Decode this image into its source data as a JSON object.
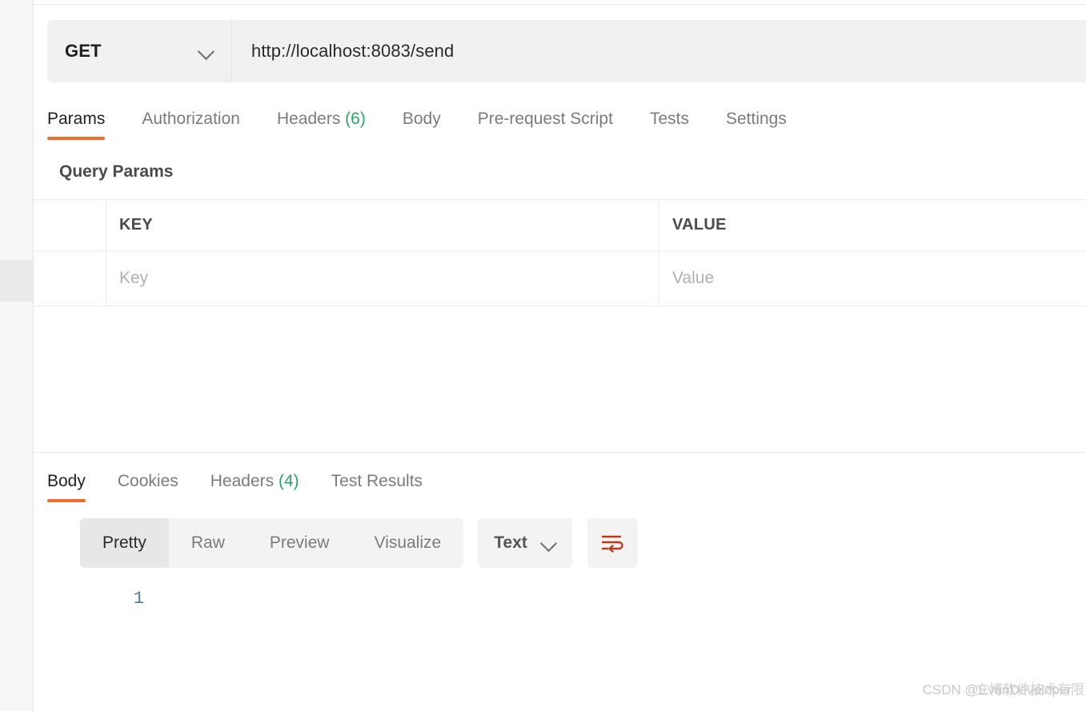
{
  "request": {
    "method": "GET",
    "url": "http://localhost:8083/send",
    "method_dropdown_icon": "chevron-down-icon",
    "tabs": [
      {
        "label": "Params",
        "count": "",
        "active": true
      },
      {
        "label": "Authorization",
        "count": "",
        "active": false
      },
      {
        "label": "Headers",
        "count": "(6)",
        "active": false
      },
      {
        "label": "Body",
        "count": "",
        "active": false
      },
      {
        "label": "Pre-request Script",
        "count": "",
        "active": false
      },
      {
        "label": "Tests",
        "count": "",
        "active": false
      },
      {
        "label": "Settings",
        "count": "",
        "active": false
      }
    ],
    "query_params": {
      "section_title": "Query Params",
      "columns": [
        "",
        "KEY",
        "VALUE"
      ],
      "rows": [
        {
          "checkbox": "",
          "key": "",
          "value": "",
          "key_placeholder": "Key",
          "value_placeholder": "Value"
        }
      ]
    }
  },
  "response": {
    "tabs": [
      {
        "label": "Body",
        "count": "",
        "active": true
      },
      {
        "label": "Cookies",
        "count": "",
        "active": false
      },
      {
        "label": "Headers",
        "count": "(4)",
        "active": false
      },
      {
        "label": "Test Results",
        "count": "",
        "active": false
      }
    ],
    "view_modes": [
      {
        "label": "Pretty",
        "active": true
      },
      {
        "label": "Raw",
        "active": false
      },
      {
        "label": "Preview",
        "active": false
      },
      {
        "label": "Visualize",
        "active": false
      }
    ],
    "format": {
      "selected": "Text",
      "icon": "chevron-down-icon"
    },
    "wrap_button_icon": "word-wrap-icon",
    "body": {
      "lines": [
        {
          "number": "1",
          "text": ""
        }
      ]
    }
  },
  "watermark": {
    "text": "CSDN @EvanDeveloper",
    "overlay_text": "立博软件技术有限"
  },
  "colors": {
    "accent": "#ef6c2f",
    "count_green": "#27a567",
    "wrap_icon": "#c0391b",
    "line_number": "#4d7f99",
    "toolbar_bg": "#f3f3f3",
    "url_bg": "#f1f1f1"
  }
}
